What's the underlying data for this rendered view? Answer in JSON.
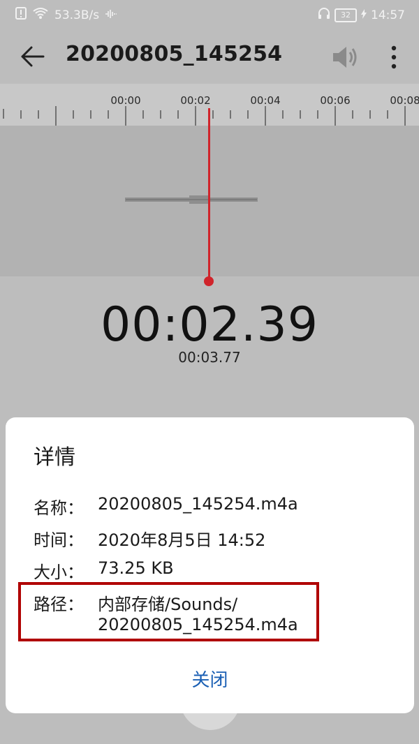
{
  "status_bar": {
    "speed": "53.3B/s",
    "battery": "32",
    "time": "14:57"
  },
  "app_bar": {
    "title": "20200805_145254"
  },
  "timeline": {
    "ticks": [
      "00:00",
      "00:02",
      "00:04",
      "00:06",
      "00:08"
    ]
  },
  "player": {
    "current_time": "00:02.39",
    "total_time": "00:03.77"
  },
  "dialog": {
    "title": "详情",
    "rows": [
      {
        "label": "名称：",
        "value": "20200805_145254.m4a"
      },
      {
        "label": "时间：",
        "value": "2020年8月5日 14:52"
      },
      {
        "label": "大小：",
        "value": "73.25 KB"
      },
      {
        "label": "路径：",
        "value": "内部存储/Sounds/",
        "value2": "20200805_145254.m4a"
      }
    ],
    "close_label": "关闭"
  },
  "colors": {
    "accent_red": "#d0242b",
    "link_blue": "#1a5fb4",
    "highlight": "#b00000"
  }
}
